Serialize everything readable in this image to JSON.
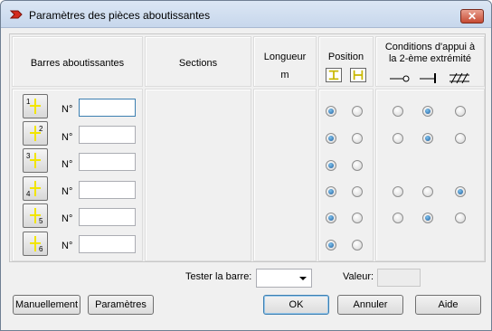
{
  "window": {
    "title": "Paramètres des pièces aboutissantes",
    "close_label": "✕"
  },
  "headers": {
    "barres": "Barres aboutissantes",
    "sections": "Sections",
    "longueur": "Longueur",
    "longueur_unit": "m",
    "position": "Position",
    "conditions_line1": "Conditions d'appui à",
    "conditions_line2": "la 2-ème extrémité"
  },
  "rows": [
    {
      "label": "N°",
      "value": "",
      "bar_number": "1",
      "position": 0,
      "conditions": 1
    },
    {
      "label": "N°",
      "value": "",
      "bar_number": "2",
      "position": 0,
      "conditions": 1
    },
    {
      "label": "N°",
      "value": "",
      "bar_number": "3",
      "position": 0,
      "conditions": null
    },
    {
      "label": "N°",
      "value": "",
      "bar_number": "4",
      "position": 0,
      "conditions": 2
    },
    {
      "label": "N°",
      "value": "",
      "bar_number": "5",
      "position": 0,
      "conditions": 1
    },
    {
      "label": "N°",
      "value": "",
      "bar_number": "6",
      "position": 0,
      "conditions": null
    }
  ],
  "footer": {
    "tester_label": "Tester la barre:",
    "tester_value": "",
    "valeur_label": "Valeur:",
    "valeur_value": ""
  },
  "buttons": {
    "manuellement": "Manuellement",
    "parametres": "Paramètres",
    "ok": "OK",
    "annuler": "Annuler",
    "aide": "Aide"
  },
  "colors": {
    "accent": "#1f5c9c",
    "bar_yellow": "#f2e500",
    "title_icon": "#d42a1c"
  }
}
